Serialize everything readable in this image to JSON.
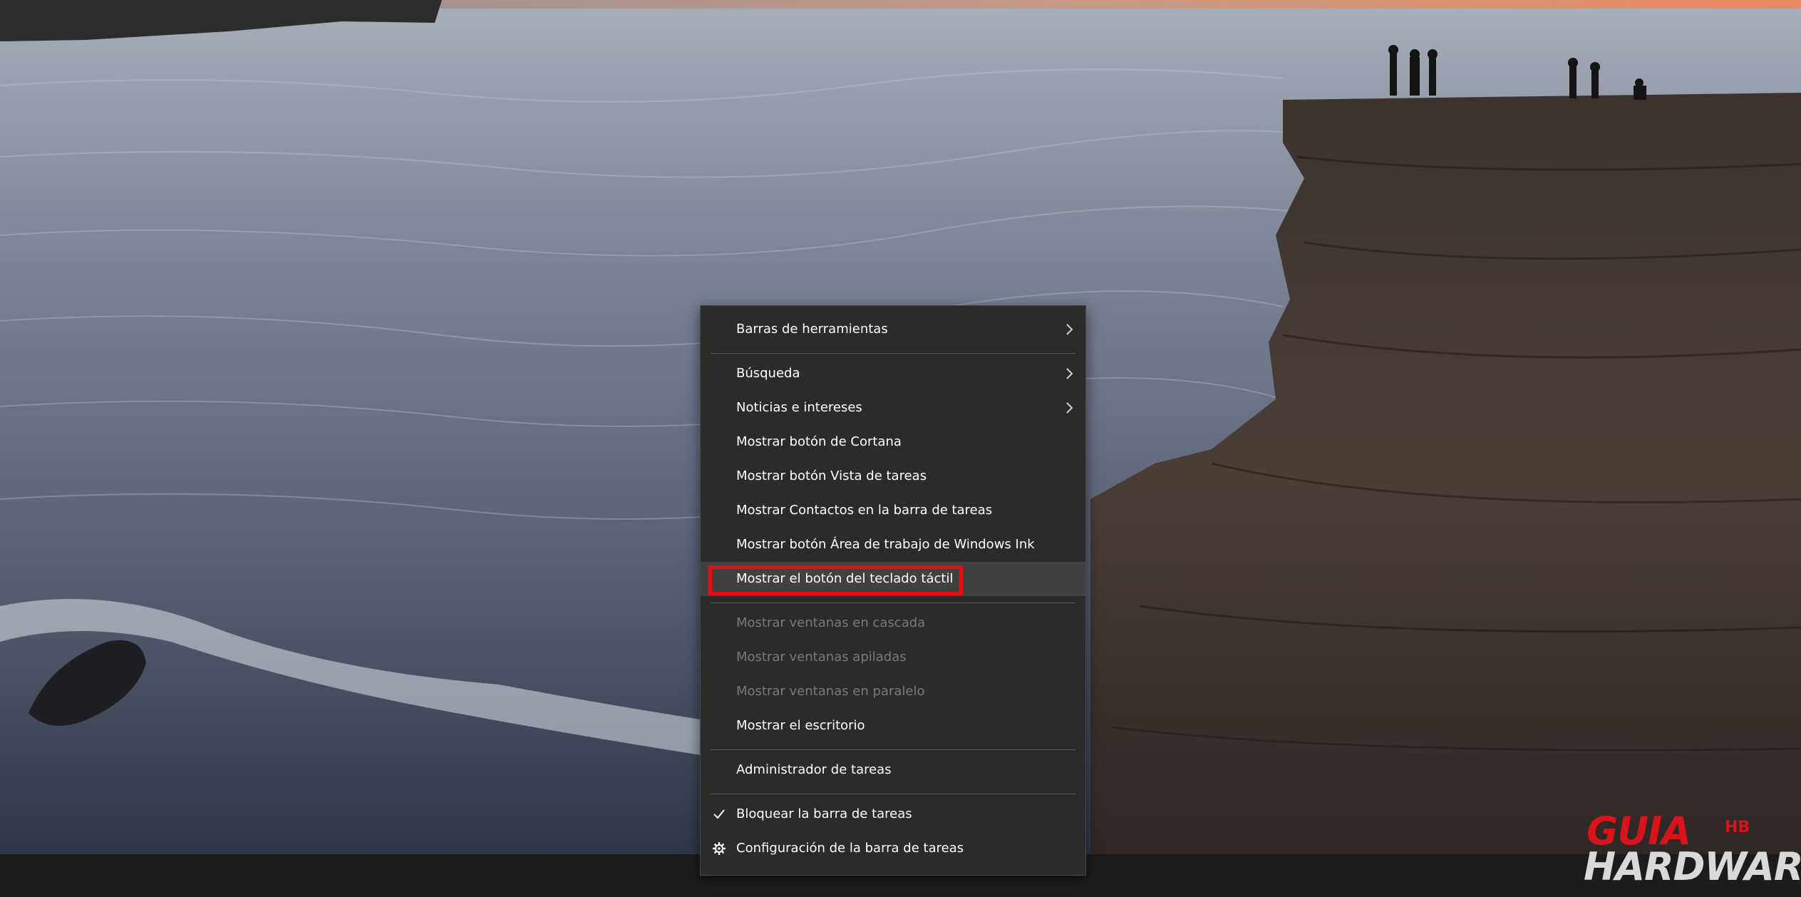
{
  "menu": {
    "items": [
      {
        "label": "Barras de herramientas",
        "submenu": true
      },
      {
        "label": "Búsqueda",
        "submenu": true
      },
      {
        "label": "Noticias e intereses",
        "submenu": true
      },
      {
        "label": "Mostrar botón de Cortana"
      },
      {
        "label": "Mostrar botón Vista de tareas"
      },
      {
        "label": "Mostrar Contactos en la barra de tareas"
      },
      {
        "label": "Mostrar botón Área de trabajo de Windows Ink"
      },
      {
        "label": "Mostrar el botón del teclado táctil",
        "hovered": true
      },
      {
        "label": "Mostrar ventanas en cascada",
        "disabled": true
      },
      {
        "label": "Mostrar ventanas apiladas",
        "disabled": true
      },
      {
        "label": "Mostrar ventanas en paralelo",
        "disabled": true
      },
      {
        "label": "Mostrar el escritorio"
      },
      {
        "label": "Administrador de tareas"
      },
      {
        "label": "Bloquear la barra de tareas",
        "icon": "checkmark-icon",
        "checked": true
      },
      {
        "label": "Configuración de la barra de tareas",
        "icon": "gear-icon"
      }
    ]
  },
  "watermark": {
    "line1": "GUIA",
    "line2": "HARDWARE",
    "badge": "HB"
  },
  "colors": {
    "menu_bg": "#2b2b2b",
    "menu_hover": "#414141",
    "highlight_box": "#e01010",
    "disabled_text": "#7a7a7a",
    "logo_red": "#d8131a"
  }
}
